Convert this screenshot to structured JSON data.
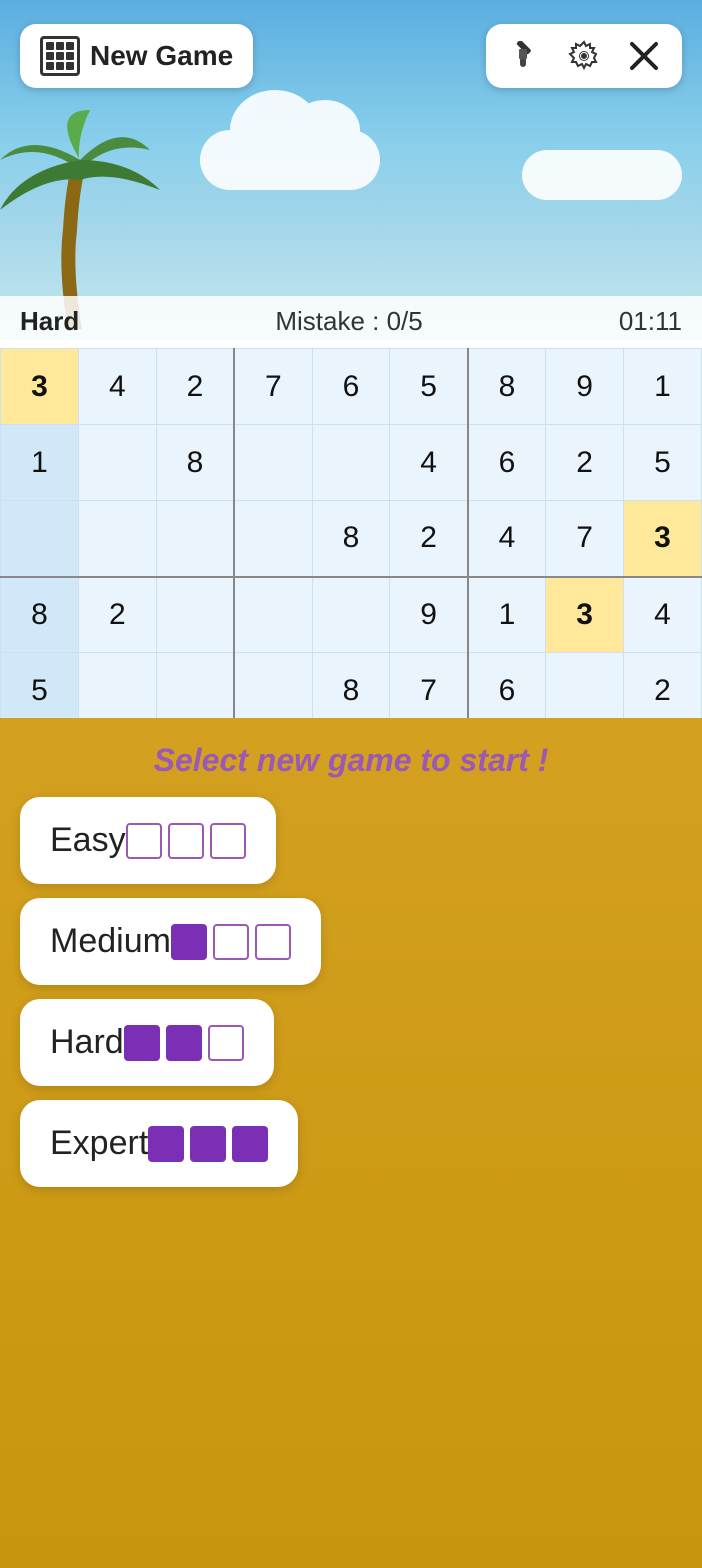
{
  "header": {
    "new_game_label": "New Game",
    "icons": {
      "brush": "🖌",
      "settings": "⚙",
      "close": "✕"
    }
  },
  "status": {
    "difficulty": "Hard",
    "mistakes_label": "Mistake : 0/5",
    "time": "01:11"
  },
  "grid": {
    "rows": [
      [
        "3",
        "4",
        "2",
        "7",
        "6",
        "5",
        "8",
        "9",
        "1"
      ],
      [
        "1",
        "",
        "8",
        "",
        "",
        "4",
        "6",
        "2",
        "5"
      ],
      [
        "",
        "",
        "",
        "",
        "8",
        "2",
        "4",
        "7",
        "3"
      ],
      [
        "8",
        "2",
        "",
        "",
        "",
        "9",
        "1",
        "3",
        "4"
      ],
      [
        "5",
        "",
        "",
        "",
        "8",
        "7",
        "6",
        "",
        "2"
      ]
    ],
    "highlighted_cells": [
      [
        0,
        0
      ],
      [
        2,
        8
      ],
      [
        3,
        7
      ]
    ]
  },
  "overlay": {
    "prompt": "Select new game to start !",
    "difficulties": [
      {
        "label": "Easy",
        "filled": 0,
        "total": 3
      },
      {
        "label": "Medium",
        "filled": 1,
        "total": 3
      },
      {
        "label": "Hard",
        "filled": 2,
        "total": 3
      },
      {
        "label": "Expert",
        "filled": 3,
        "total": 3
      }
    ]
  },
  "colors": {
    "filled_bar": "#7b2fb5",
    "empty_bar_border": "#9b59b6",
    "prompt_color": "#9b59b6",
    "highlight_yellow": "#ffe89a"
  }
}
